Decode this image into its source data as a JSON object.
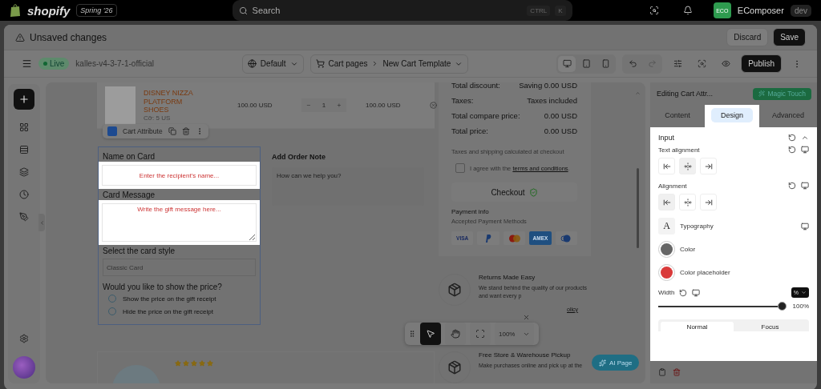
{
  "top_bar": {
    "brand": "shopify",
    "edition": "Spring '26",
    "search": {
      "placeholder": "Search",
      "shortcut": [
        "CTRL",
        "K"
      ]
    },
    "avatar": "ECO",
    "account": "EComposer",
    "account_badge": "dev"
  },
  "notice": {
    "message": "Unsaved changes",
    "buttons": [
      "Discard",
      "Save"
    ]
  },
  "toolbar": {
    "status": "Live",
    "store": "kalles-v4-3-7-1-official",
    "locale": "Default",
    "breadcrumb": [
      "Cart pages",
      "New Cart Template"
    ],
    "devices": [
      {
        "kind": "desktop",
        "selected": true
      },
      {
        "kind": "tablet",
        "selected": false
      },
      {
        "kind": "mobile",
        "selected": false
      }
    ],
    "publish": "Publish"
  },
  "cart_item": {
    "name": "DISNEY NIZZA PLATFORM SHOES",
    "variant": "Cỡ: 5 US",
    "price": "100.00 USD",
    "quantity": "1",
    "total": "100.00 USD"
  },
  "element_toolbar": {
    "label": "Cart Attribute"
  },
  "form": {
    "fields": [
      {
        "kind": "text",
        "label": "Name on Card",
        "placeholder": "Enter the recipient's name..."
      },
      {
        "kind": "textarea",
        "label": "Card Message",
        "placeholder": "Write the gift message here..."
      },
      {
        "kind": "select",
        "label": "Select the card style",
        "value": "Classic Card"
      },
      {
        "kind": "radio",
        "label": "Would you like to show the price?",
        "options": [
          {
            "label": "Show the price on the gift receipt",
            "selected": false
          },
          {
            "label": "Hide the price on the gift receipt",
            "selected": false
          }
        ]
      }
    ]
  },
  "order_note": {
    "title": "Add Order Note",
    "placeholder": "How can we help you?"
  },
  "summary": {
    "rows": [
      {
        "label": "Total discount:",
        "value": "Saving 0.00 USD"
      },
      {
        "label": "Taxes:",
        "value": "Taxes included"
      },
      {
        "label": "Total compare price:",
        "value": "0.00 USD"
      },
      {
        "label": "Total price:",
        "value": "0.00 USD"
      }
    ],
    "note": "Taxes and shipping calculated at checkout",
    "agree": {
      "text": "I agree with the ",
      "link": "terms and conditions",
      "end": ".",
      "checked": false
    },
    "checkout": "Checkout",
    "payment_title": "Payment info",
    "payment_subtitle": "Accepted Payment Methods",
    "payment_methods": [
      {
        "kind": "visa",
        "label": "VISA"
      },
      {
        "kind": "paypal"
      },
      {
        "kind": "mastercard"
      },
      {
        "kind": "amex",
        "label": "AMEX"
      },
      {
        "kind": "diners"
      }
    ]
  },
  "features": [
    {
      "title": "Returns Made Easy",
      "text": "We stand behind the quality of our products and want every p",
      "link": "olicy"
    },
    {
      "title": "Free Store & Warehouse Pickup",
      "text": "Make purchases online and pick up at the"
    }
  ],
  "review": {
    "stars": 5
  },
  "canvas_tools": {
    "tools": [
      {
        "kind": "pointer",
        "selected": true
      },
      {
        "kind": "hand",
        "selected": false
      },
      {
        "kind": "fit",
        "selected": false
      }
    ],
    "zoom": "100%"
  },
  "ai_button": "AI Page",
  "panel": {
    "title": "Editing Cart Attr...",
    "magic": "Magic Touch",
    "tabs": [
      {
        "label": "Content",
        "selected": false
      },
      {
        "label": "Design",
        "selected": true
      },
      {
        "label": "Advanced",
        "selected": false
      }
    ],
    "section": "Input",
    "text_alignment": {
      "label": "Text alignment",
      "options": [
        {
          "kind": "left",
          "selected": false
        },
        {
          "kind": "center",
          "selected": true
        },
        {
          "kind": "right",
          "selected": false
        }
      ]
    },
    "alignment": {
      "label": "Alignment",
      "options": [
        {
          "kind": "left",
          "selected": true
        },
        {
          "kind": "center",
          "selected": false
        },
        {
          "kind": "right",
          "selected": false
        }
      ]
    },
    "typography": {
      "glyph": "A",
      "label": "Typography"
    },
    "colors": [
      {
        "label": "Color",
        "color": "#666666"
      },
      {
        "label": "Color placeholder",
        "color": "#d93a3a"
      }
    ],
    "width": {
      "label": "Width",
      "unit": "%",
      "level": 1,
      "reading": "100%"
    },
    "states": [
      {
        "label": "Normal",
        "selected": true
      },
      {
        "label": "Focus",
        "selected": false
      }
    ]
  }
}
